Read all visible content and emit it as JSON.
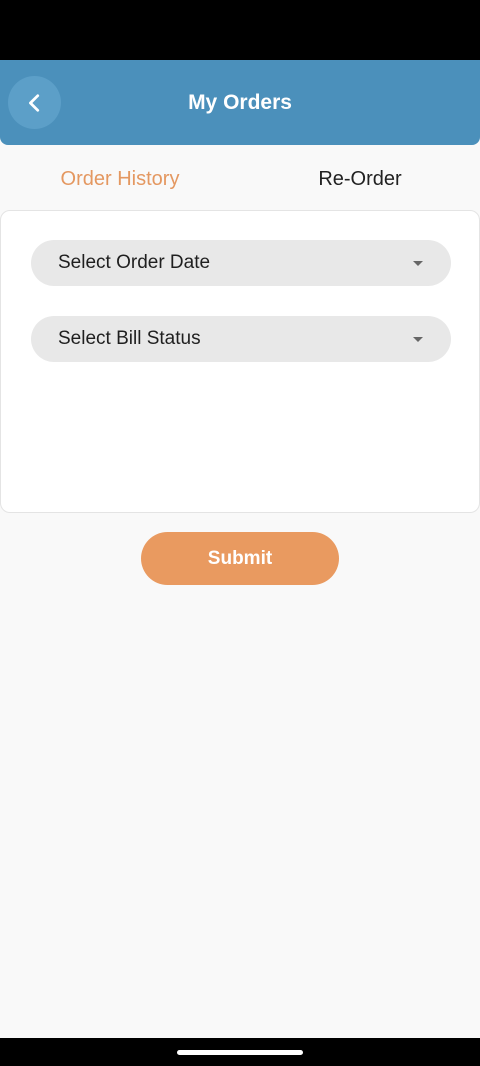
{
  "header": {
    "title": "My Orders",
    "back_icon": "chevron-left-icon",
    "background_color": "#4b90bb"
  },
  "tabs": [
    {
      "label": "Order History",
      "active": true,
      "color": "#e49861"
    },
    {
      "label": "Re-Order",
      "active": false,
      "color": "#222222"
    }
  ],
  "filters": {
    "order_date": {
      "label": "Select Order Date",
      "icon": "caret-down-icon"
    },
    "bill_status": {
      "label": "Select Bill Status",
      "icon": "caret-down-icon"
    }
  },
  "submit": {
    "label": "Submit",
    "color": "#e99a60"
  }
}
